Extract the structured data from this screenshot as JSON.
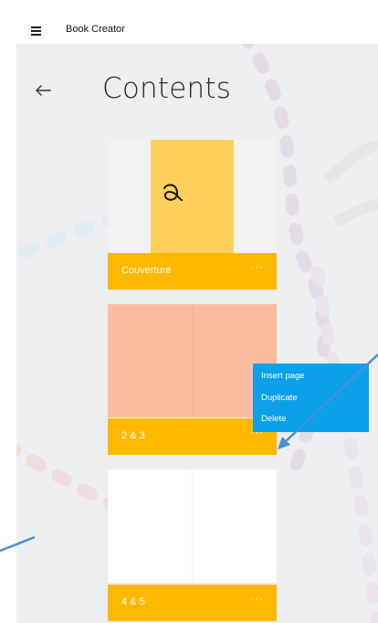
{
  "window": {
    "title": "Book Creator",
    "menu_icon": "hamburger-icon"
  },
  "header": {
    "back_icon": "arrow-left-icon",
    "title": "Contents"
  },
  "pages": [
    {
      "label": "Couverture",
      "more": "···"
    },
    {
      "label": "2 & 3",
      "more": "···"
    },
    {
      "label": "4 & 5",
      "more": "···"
    }
  ],
  "context_menu": {
    "items": [
      "Insert page",
      "Duplicate",
      "Delete"
    ]
  },
  "colors": {
    "accent_yellow": "#ffb800",
    "menu_blue": "#0aa1ea",
    "annotation_arrow": "#4a8fd6",
    "background": "#eceeef"
  }
}
